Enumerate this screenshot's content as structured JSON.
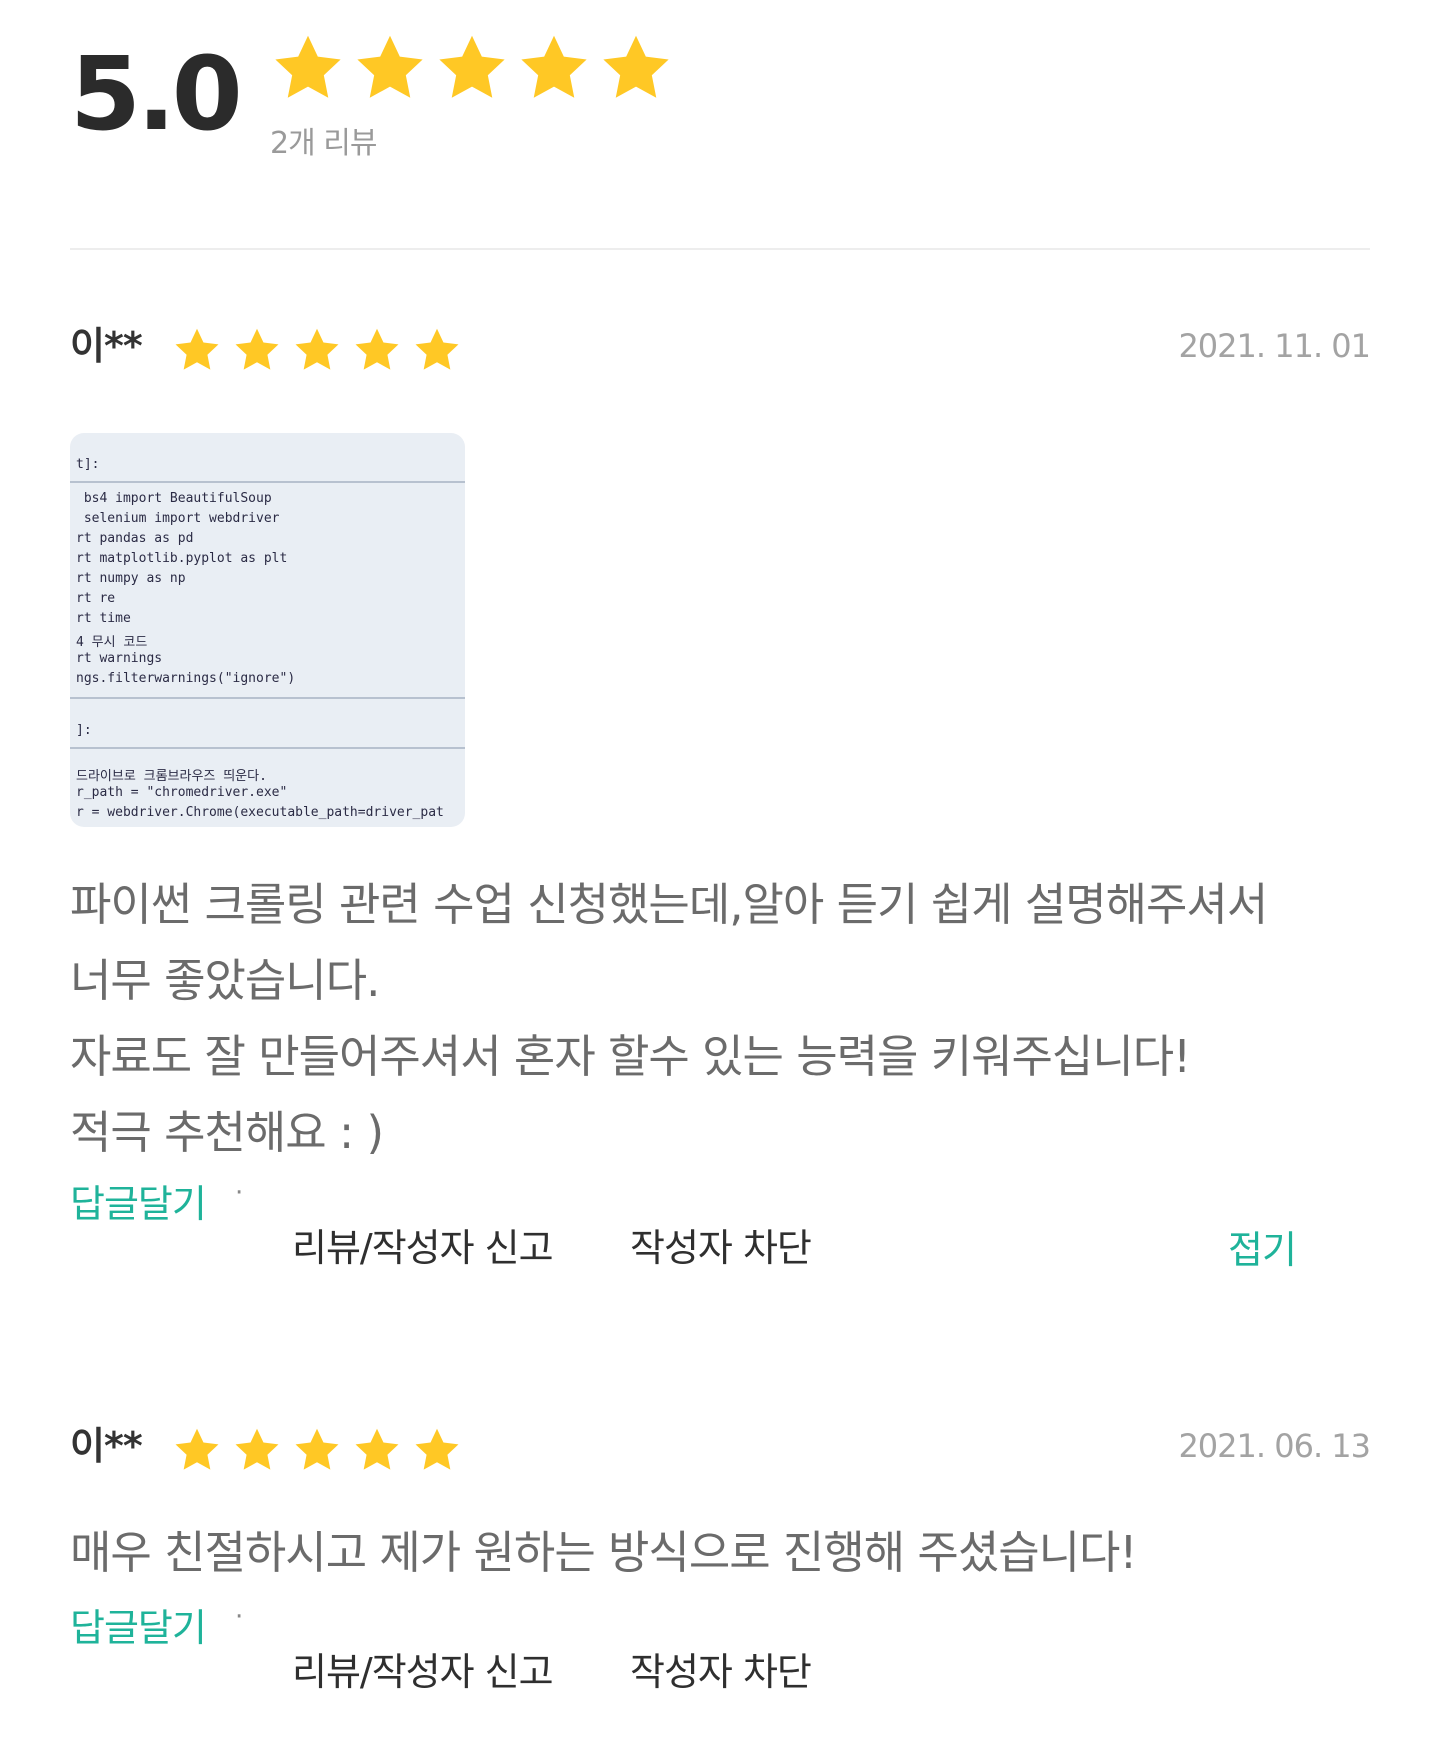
{
  "summary": {
    "rating": "5.0",
    "stars": 5,
    "count_text": "2개 리뷰"
  },
  "colors": {
    "star": "#FFC825",
    "accent": "#1FB39A"
  },
  "reviews": [
    {
      "author": "이**",
      "stars": 5,
      "date": "2021. 11. 01",
      "photo": {
        "lines": [
          "t]:",
          " bs4 import BeautifulSoup",
          " selenium import webdriver",
          "rt pandas as pd",
          "rt matplotlib.pyplot as plt",
          "rt numpy as np",
          "rt re",
          "rt time",
          "4 무시 코드",
          "rt warnings",
          "ngs.filterwarnings(\"ignore\")",
          "]:",
          "드라이브로 크롬브라우즈 띄운다.",
          "r_path = \"chromedriver.exe\"",
          "r = webdriver.Chrome(executable_path=driver_pat"
        ]
      },
      "text_lines": [
        "파이썬 크롤링 관련 수업 신청했는데,알아 듣기 쉽게 설명해주셔서",
        "너무 좋았습니다.",
        "자료도 잘 만들어주셔서 혼자 할수 있는 능력을 키워주십니다!",
        "적극 추천해요 : )"
      ],
      "reply_label": "답글달기",
      "separator": "·",
      "report_label": "리뷰/작성자 신고",
      "block_label": "작성자 차단",
      "fold_label": "접기"
    },
    {
      "author": "이**",
      "stars": 5,
      "date": "2021. 06. 13",
      "text_lines": [
        "매우 친절하시고 제가 원하는 방식으로 진행해 주셨습니다!"
      ],
      "reply_label": "답글달기",
      "separator": "·",
      "report_label": "리뷰/작성자 신고",
      "block_label": "작성자 차단"
    }
  ]
}
